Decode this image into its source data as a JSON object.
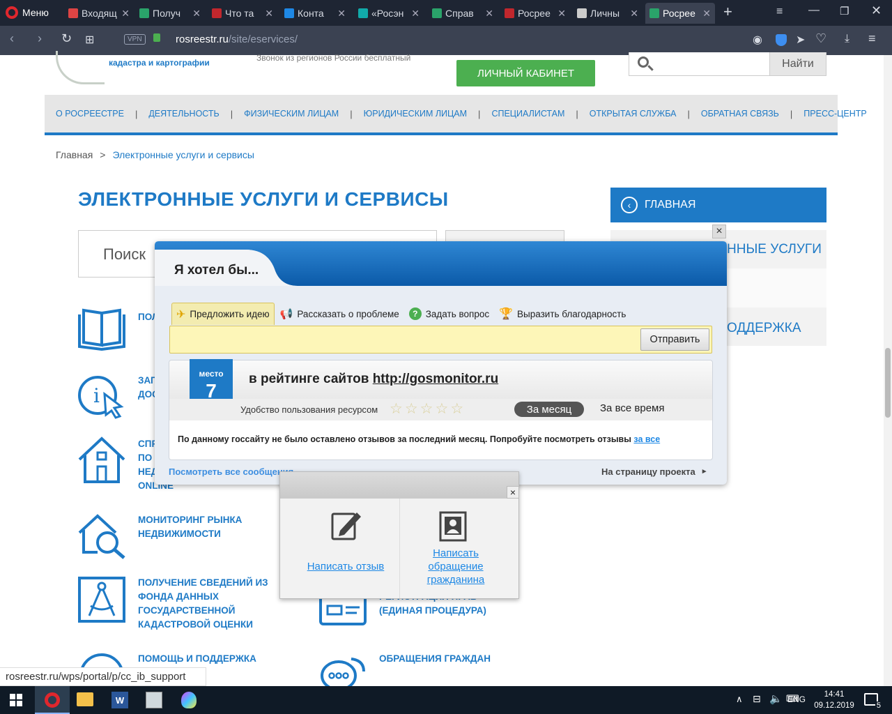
{
  "browser": {
    "menu_label": "Меню",
    "tabs": [
      {
        "label": "Входящ",
        "fav": "#d44"
      },
      {
        "label": "Получ",
        "fav": "#2aa36a"
      },
      {
        "label": "Что та",
        "fav": "#c1272d"
      },
      {
        "label": "Конта",
        "fav": "#1e88e5"
      },
      {
        "label": "«Росэн",
        "fav": "#1aa"
      },
      {
        "label": "Справ",
        "fav": "#2aa36a"
      },
      {
        "label": "Росрее",
        "fav": "#c1272d"
      },
      {
        "label": "Личны",
        "fav": "#ccc"
      },
      {
        "label": "Росрее",
        "fav": "#2aa36a"
      }
    ],
    "url_domain": "rosreestr.ru",
    "url_path": "/site/eservices/",
    "vpn_label": "VPN"
  },
  "header": {
    "org_line": "кадастра и картографии",
    "phone_note": "Звонок из регионов России бесплатный",
    "cabinet_button": "ЛИЧНЫЙ КАБИНЕТ",
    "search_button": "Найти"
  },
  "nav": {
    "items": [
      "О РОСРЕЕСТРЕ",
      "ДЕЯТЕЛЬНОСТЬ",
      "ФИЗИЧЕСКИМ ЛИЦАМ",
      "ЮРИДИЧЕСКИМ ЛИЦАМ",
      "СПЕЦИАЛИСТАМ",
      "ОТКРЫТАЯ СЛУЖБА",
      "ОБРАТНАЯ СВЯЗЬ",
      "ПРЕСС-ЦЕНТР"
    ],
    "sep": "|"
  },
  "breadcrumb": {
    "home": "Главная",
    "sep": ">",
    "current": "Электронные услуги и сервисы"
  },
  "page_title": "ЭЛЕКТРОННЫЕ УСЛУГИ И СЕРВИСЫ",
  "search": {
    "placeholder": "Поиск"
  },
  "sidebar": {
    "home_label": "ГЛАВНАЯ",
    "item1": "ННЫЕ УСЛУГИ",
    "item2": "ОДДЕРЖКА"
  },
  "services": {
    "s1": "ПОЛ",
    "s2a": "ЗАП",
    "s2b": "ДОС",
    "s3a": "СПР",
    "s3b": "ПО",
    "s3c": "НЕД",
    "s3d": "ONLINE",
    "s4": "МОНИТОРИНГ РЫНКА НЕДВИЖИМОСТИ",
    "s5": "ПОЛУЧЕНИЕ СВЕДЕНИЙ ИЗ ФОНДА ДАННЫХ ГОСУДАРСТВЕННОЙ КАДАСТРОВОЙ ОЦЕНКИ",
    "s6": "РЕГИСТРАЦИЯ ПРАВ (ЕДИНАЯ ПРОЦЕДУРА)",
    "s7": "ПОМОЩЬ И ПОДДЕРЖКА",
    "s8": "ОБРАЩЕНИЯ ГРАЖДАН"
  },
  "popup": {
    "title": "Я хотел бы...",
    "tabs": [
      "Предложить идею",
      "Рассказать о проблеме",
      "Задать вопрос",
      "Выразить благодарность"
    ],
    "send_button": "Отправить",
    "badge_label": "место",
    "badge_number": "7",
    "rating_title": "в рейтинге сайтов ",
    "rating_link": "http://gosmonitor.ru",
    "usability_label": "Удобство пользования ресурсом",
    "stars_filled": 0,
    "stars_total": 5,
    "period_month": "За месяц",
    "period_all": "За все время",
    "empty_note": "По данному госсайту не было оставлено отзывов за последний месяц. Попробуйте посмотреть отзывы ",
    "empty_link": "за все",
    "view_all": "Посмотреть все сообщения",
    "project_link": "На страницу проекта",
    "close_glyph": "×"
  },
  "subpopup": {
    "write_review": "Написать отзыв",
    "write_appeal": "Написать обращение гражданина",
    "close_glyph": "×"
  },
  "statusbar": {
    "url": "rosreestr.ru/wps/portal/p/cc_ib_support"
  },
  "taskbar": {
    "lang": "ENG",
    "time": "14:41",
    "date": "09.12.2019",
    "notif_count": "5"
  }
}
